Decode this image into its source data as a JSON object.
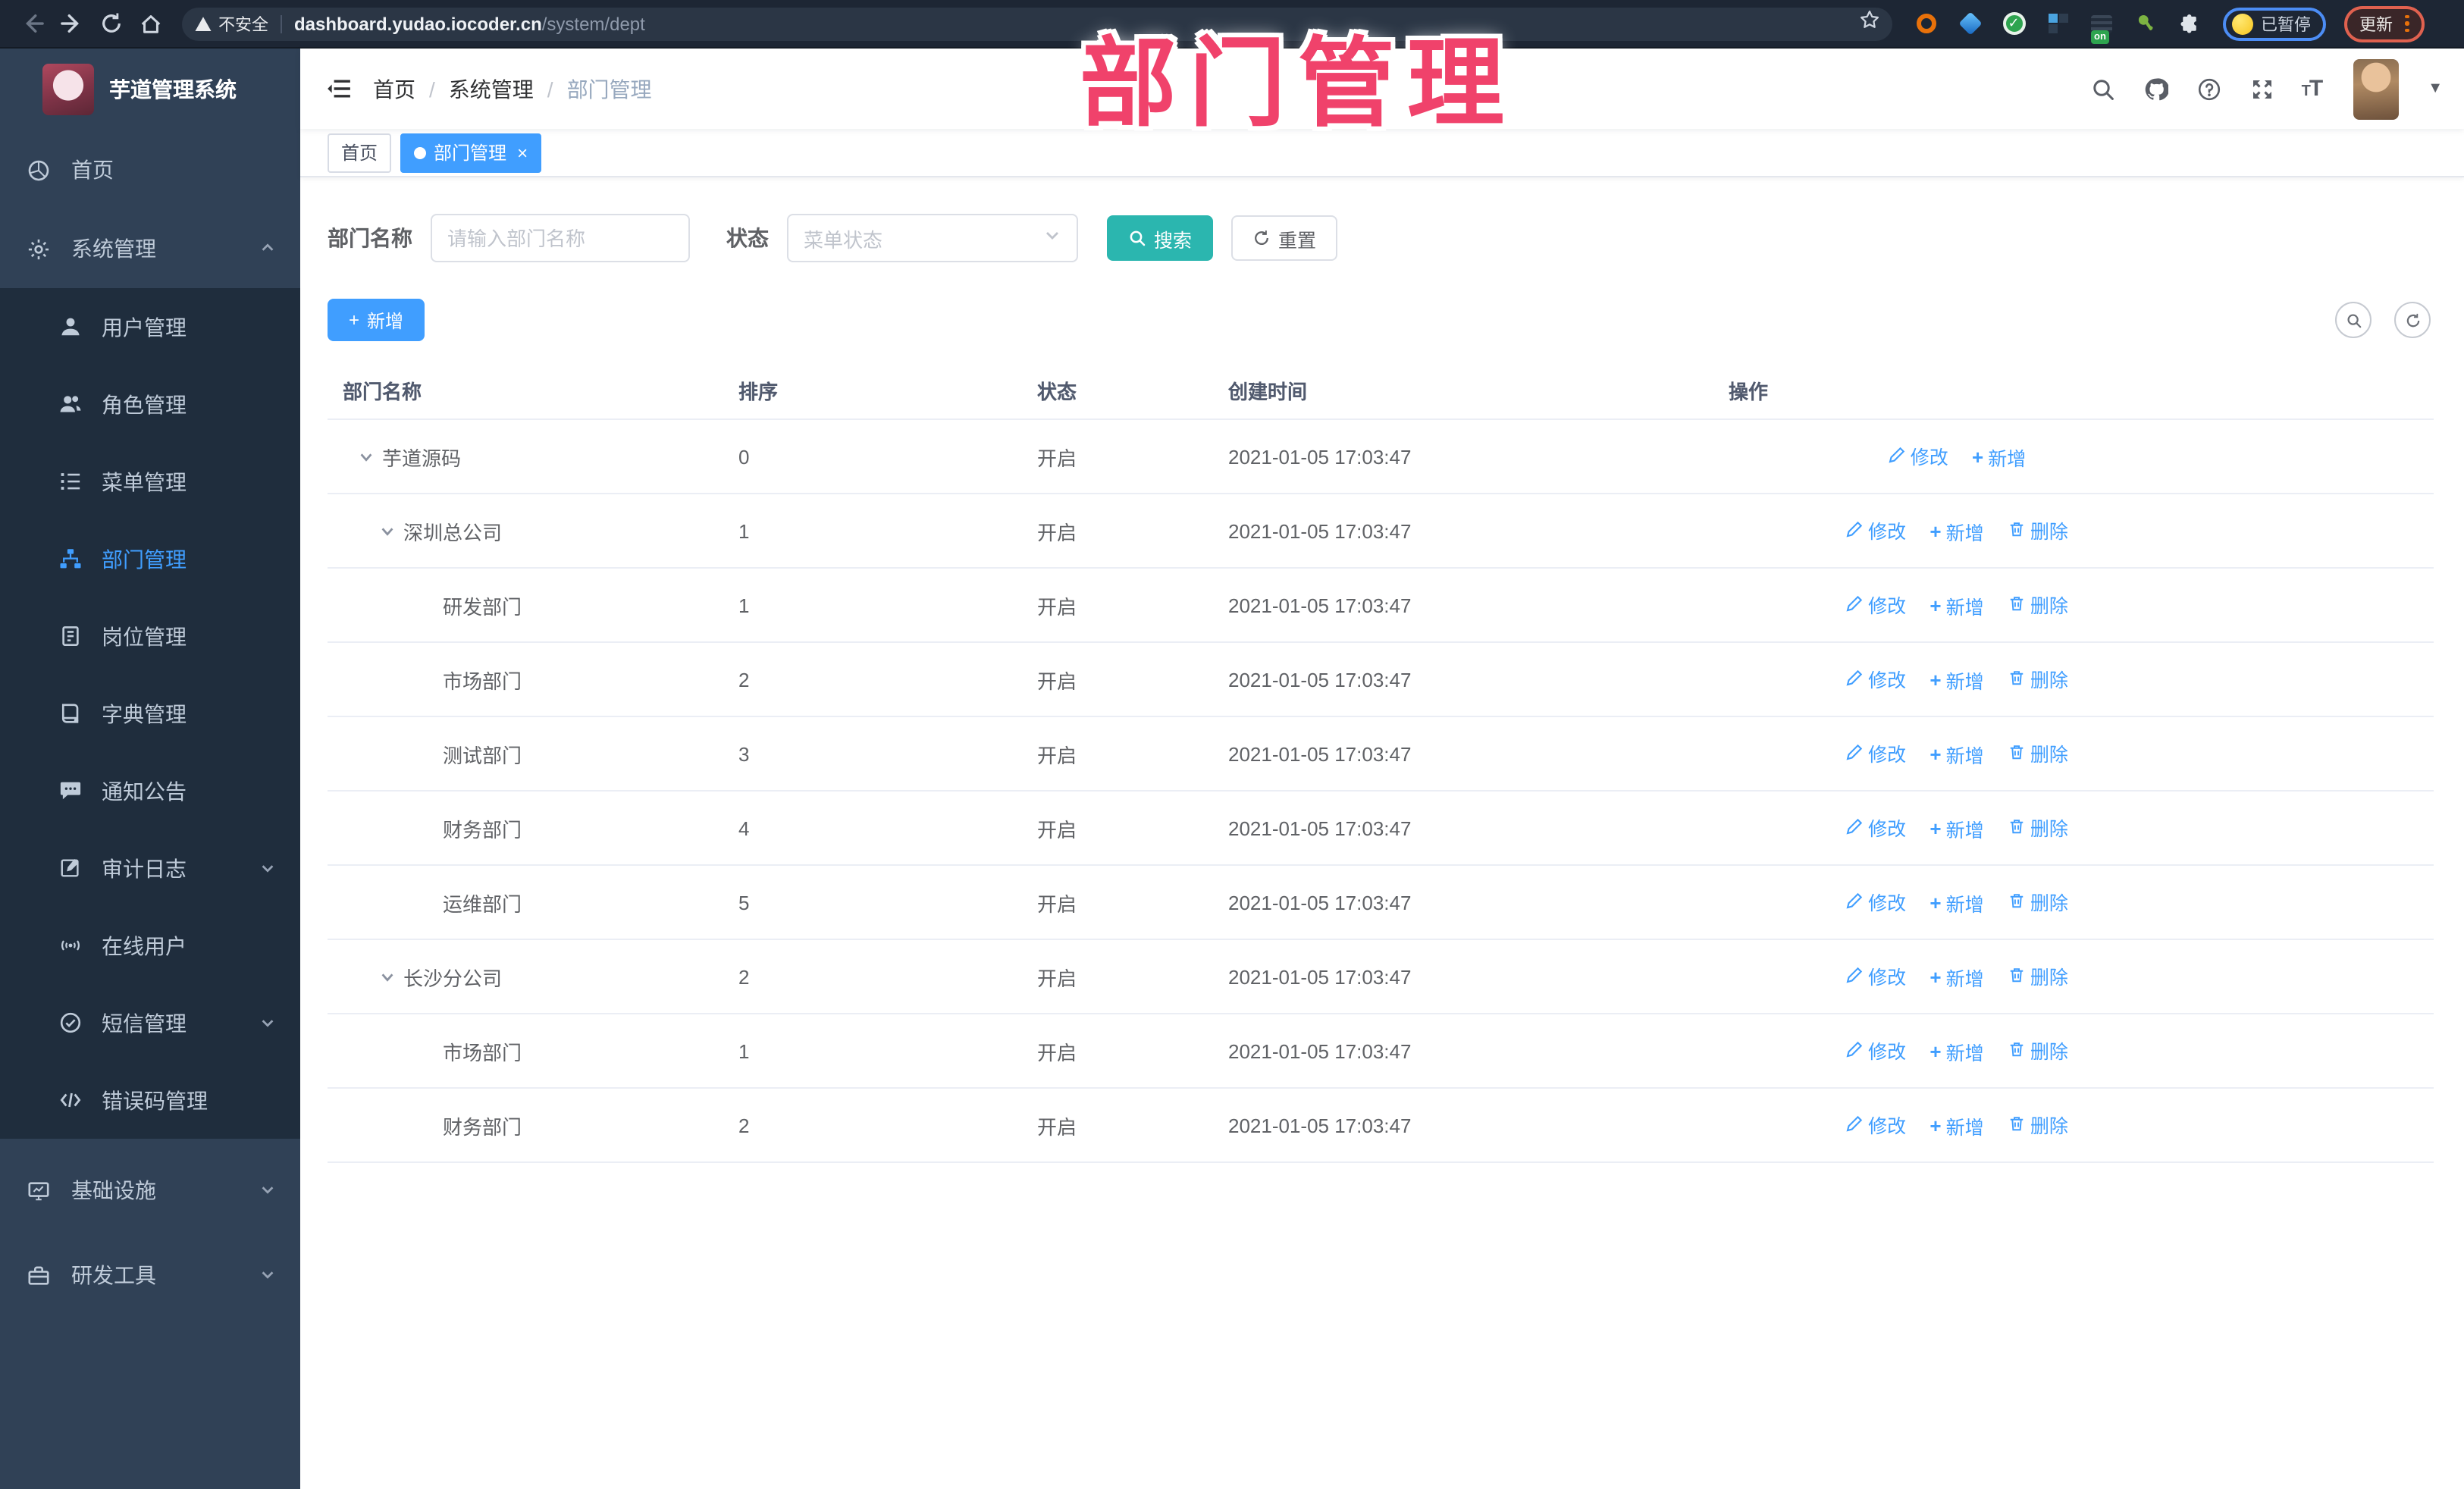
{
  "browser": {
    "security_label": "不安全",
    "url_domain": "dashboard.yudao.iocoder.cn",
    "url_path": "/system/dept",
    "extension_badge": "on",
    "profile_status": "已暂停",
    "update_label": "更新"
  },
  "annotation": {
    "text": "部门管理"
  },
  "sidebar": {
    "app_title": "芋道管理系统",
    "items": [
      {
        "label": "首页"
      },
      {
        "label": "系统管理"
      },
      {
        "label": "基础设施"
      },
      {
        "label": "研发工具"
      }
    ],
    "system_children": [
      {
        "label": "用户管理"
      },
      {
        "label": "角色管理"
      },
      {
        "label": "菜单管理"
      },
      {
        "label": "部门管理"
      },
      {
        "label": "岗位管理"
      },
      {
        "label": "字典管理"
      },
      {
        "label": "通知公告"
      },
      {
        "label": "审计日志"
      },
      {
        "label": "在线用户"
      },
      {
        "label": "短信管理"
      },
      {
        "label": "错误码管理"
      }
    ]
  },
  "header": {
    "breadcrumb": [
      {
        "label": "首页"
      },
      {
        "label": "系统管理"
      },
      {
        "label": "部门管理"
      }
    ]
  },
  "tags": [
    {
      "label": "首页"
    },
    {
      "label": "部门管理"
    }
  ],
  "filters": {
    "dept_name_label": "部门名称",
    "dept_name_placeholder": "请输入部门名称",
    "status_label": "状态",
    "status_placeholder": "菜单状态",
    "search_label": "搜索",
    "reset_label": "重置"
  },
  "toolbar": {
    "add_label": "新增"
  },
  "table": {
    "columns": [
      {
        "label": "部门名称"
      },
      {
        "label": "排序"
      },
      {
        "label": "状态"
      },
      {
        "label": "创建时间"
      },
      {
        "label": "操作"
      }
    ],
    "action_labels": {
      "edit": "修改",
      "add": "新增",
      "delete": "删除"
    },
    "rows": [
      {
        "name": "芋道源码",
        "sort": "0",
        "status": "开启",
        "created": "2021-01-05 17:03:47"
      },
      {
        "name": "深圳总公司",
        "sort": "1",
        "status": "开启",
        "created": "2021-01-05 17:03:47"
      },
      {
        "name": "研发部门",
        "sort": "1",
        "status": "开启",
        "created": "2021-01-05 17:03:47"
      },
      {
        "name": "市场部门",
        "sort": "2",
        "status": "开启",
        "created": "2021-01-05 17:03:47"
      },
      {
        "name": "测试部门",
        "sort": "3",
        "status": "开启",
        "created": "2021-01-05 17:03:47"
      },
      {
        "name": "财务部门",
        "sort": "4",
        "status": "开启",
        "created": "2021-01-05 17:03:47"
      },
      {
        "name": "运维部门",
        "sort": "5",
        "status": "开启",
        "created": "2021-01-05 17:03:47"
      },
      {
        "name": "长沙分公司",
        "sort": "2",
        "status": "开启",
        "created": "2021-01-05 17:03:47"
      },
      {
        "name": "市场部门",
        "sort": "1",
        "status": "开启",
        "created": "2021-01-05 17:03:47"
      },
      {
        "name": "财务部门",
        "sort": "2",
        "status": "开启",
        "created": "2021-01-05 17:03:47"
      }
    ]
  },
  "colors": {
    "accent": "#409eff",
    "search_button": "#2bb6af",
    "annotation_pink": "#f0426b",
    "sidebar_bg": "#304156",
    "sidebar_submenu_bg": "#1f2d3d",
    "active_tag_bg": "#409eff"
  }
}
